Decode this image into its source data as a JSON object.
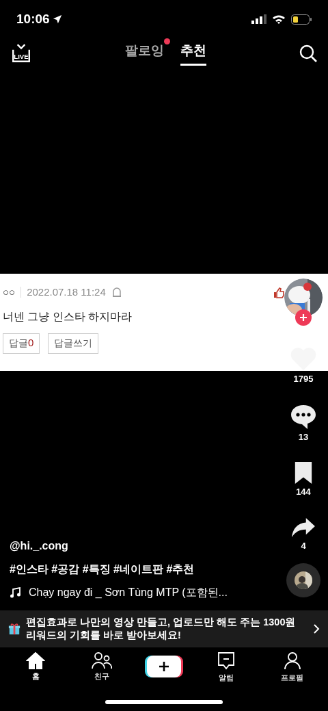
{
  "status_bar": {
    "time": "10:06"
  },
  "top_nav": {
    "live_label": "LIVE",
    "tabs": [
      {
        "label": "팔로잉",
        "selected": false,
        "dot": true
      },
      {
        "label": "추천",
        "selected": true,
        "dot": false
      }
    ]
  },
  "comment_card": {
    "author": "○○",
    "date": "2022.07.18 11:24",
    "text": "너넨 그냥 인스타 하지마라",
    "reply_count_label": "답글",
    "reply_count": "0",
    "write_reply": "답글쓰기"
  },
  "actions": [
    {
      "kind": "like",
      "count": "1795"
    },
    {
      "kind": "comment",
      "count": "13"
    },
    {
      "kind": "bookmark",
      "count": "144"
    },
    {
      "kind": "share",
      "count": "4"
    }
  ],
  "caption": {
    "username": "@hi._.cong",
    "hashtags": "#인스타 #공감 #특징 #네이트판 #추천",
    "music": "Chạy ngay đi _ Sơn Tùng MTP (포함된..."
  },
  "banner": {
    "text": "편집효과로 나만의 영상 만들고, 업로드만 해도 주는 1300원 리워드의 기회를 바로 받아보세요!"
  },
  "tab_bar": [
    {
      "kind": "home",
      "label": "홈",
      "selected": true
    },
    {
      "kind": "friends",
      "label": "친구",
      "selected": false
    },
    {
      "kind": "create",
      "selected": false
    },
    {
      "kind": "inbox",
      "label": "알림",
      "selected": false
    },
    {
      "kind": "profile",
      "label": "프로필",
      "selected": false
    }
  ]
}
